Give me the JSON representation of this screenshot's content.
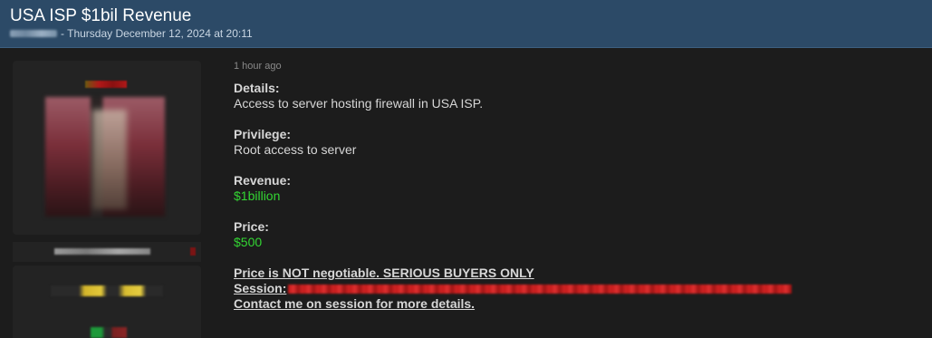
{
  "thread": {
    "title": "USA ISP $1bil Revenue",
    "date": "- Thursday December 12, 2024 at 20:11"
  },
  "post": {
    "time_ago": "1 hour ago",
    "fields": [
      {
        "label": "Details:",
        "value": "Access to server hosting firewall in USA ISP.",
        "color": "#d6d6d6"
      },
      {
        "label": "Privilege:",
        "value": "Root access to server",
        "color": "#d6d6d6"
      },
      {
        "label": "Revenue:",
        "value": "$1billion",
        "color": "#33d633"
      },
      {
        "label": "Price:",
        "value": "$500",
        "color": "#33d633"
      }
    ],
    "notice": "Price is NOT negotiable. SERIOUS BUYERS ONLY",
    "session_label": "Session:",
    "contact": "Contact me on session for more details."
  },
  "colors": {
    "header_bg": "#2c4a67",
    "page_bg": "#1c1c1c",
    "accent_green": "#33d633"
  }
}
